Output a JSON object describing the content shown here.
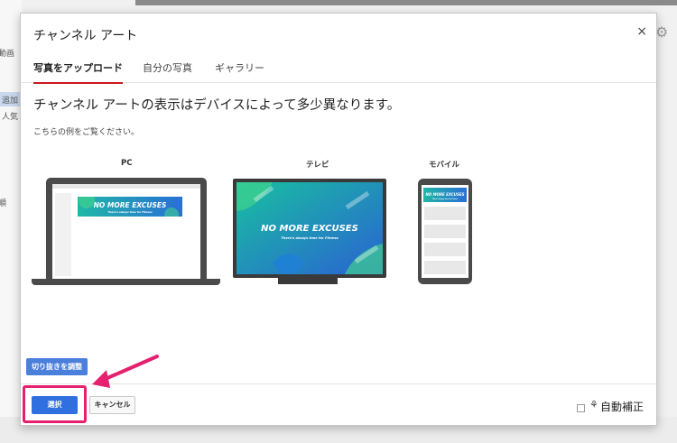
{
  "background": {
    "left_items": [
      "動画",
      "追加",
      "人気",
      "順"
    ]
  },
  "dialog": {
    "title": "チャンネル アート",
    "close_icon": "close-icon",
    "tabs": [
      {
        "label": "写真をアップロード",
        "active": true
      },
      {
        "label": "自分の写真",
        "active": false
      },
      {
        "label": "ギャラリー",
        "active": false
      }
    ],
    "headline": "チャンネル アートの表示はデバイスによって多少異なります。",
    "subtext": "こちらの例をご覧ください。",
    "devices": [
      {
        "label": "PC"
      },
      {
        "label": "テレビ"
      },
      {
        "label": "モバイル"
      }
    ],
    "banner": {
      "title": "NO MORE EXCUSES",
      "subtitle": "There's always time for Fitness"
    },
    "crop_button": "切り抜きを調整",
    "select_button": "選択",
    "cancel_button": "キャンセル",
    "auto_fix": {
      "label": "自動補正",
      "checked": false,
      "icon": "magic-wand-icon"
    }
  },
  "colors": {
    "accent_red": "#cc181e",
    "primary_blue": "#2f6fe0",
    "highlight_pink": "#e5216f",
    "banner_teal": "#1fb7a6",
    "banner_blue": "#2a6fd6"
  }
}
